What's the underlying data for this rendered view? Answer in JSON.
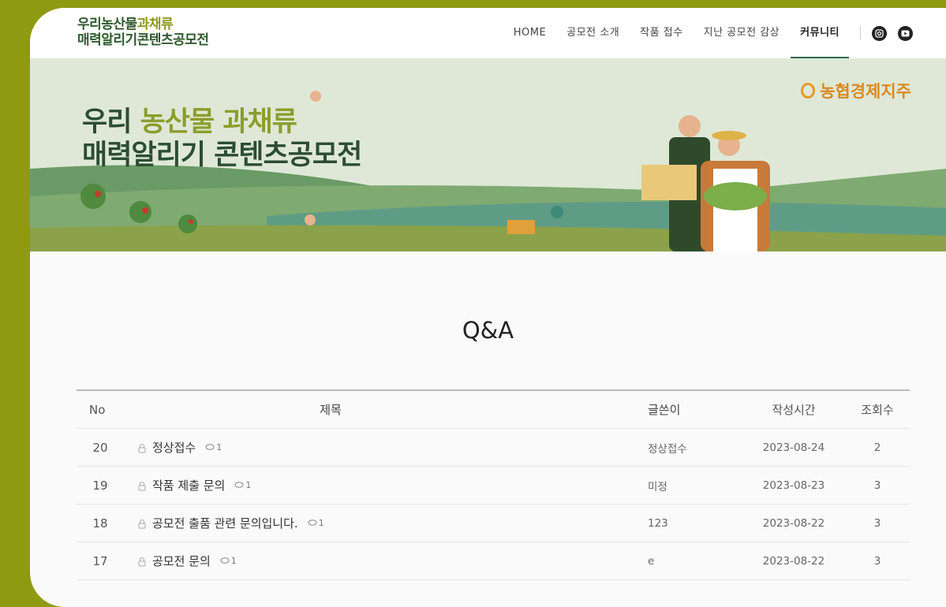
{
  "header": {
    "logo_line1_a": "우리농산물",
    "logo_line1_b": "과채류",
    "logo_line2": "매력알리기콘텐츠공모전",
    "nav": [
      "HOME",
      "공모전 소개",
      "작품 접수",
      "지난 공모전 감상",
      "커뮤니티"
    ],
    "social": [
      "instagram-icon",
      "youtube-icon"
    ]
  },
  "banner": {
    "title_l1_a": "우리 ",
    "title_l1_b": "농산물 과채류",
    "title_l2": "매력알리기 콘텐츠공모전",
    "brand": "농협경제지주"
  },
  "page_title": "Q&A",
  "board": {
    "headers": {
      "no": "No",
      "title": "제목",
      "author": "글쓴이",
      "date": "작성시간",
      "views": "조회수"
    },
    "rows": [
      {
        "no": "20",
        "title": "정상접수",
        "comments": "1",
        "author": "정상접수",
        "date": "2023-08-24",
        "views": "2"
      },
      {
        "no": "19",
        "title": "작품 제출 문의",
        "comments": "1",
        "author": "미정",
        "date": "2023-08-23",
        "views": "3"
      },
      {
        "no": "18",
        "title": "공모전 출품 관련 문의입니다.",
        "comments": "1",
        "author": "123",
        "date": "2023-08-22",
        "views": "3"
      },
      {
        "no": "17",
        "title": "공모전 문의",
        "comments": "1",
        "author": "e",
        "date": "2023-08-22",
        "views": "3"
      }
    ]
  }
}
